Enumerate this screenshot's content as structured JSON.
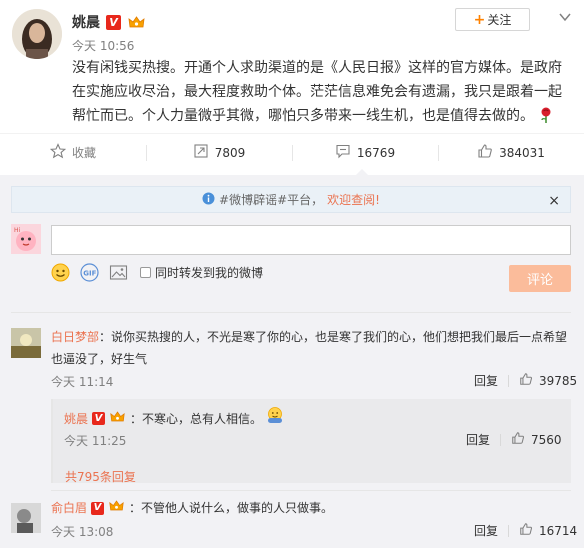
{
  "post": {
    "author": "姚晨",
    "verified_badge": "V",
    "time": "今天 10:56",
    "follow_label": "关注",
    "text_lines": [
      "没有闲钱买热搜。开通个人求助渠道的是《人民日报》这样的官方媒体。是政府",
      "在实施应收尽治，最大程度救助个体。茫茫信息难免会有遗漏，我只是跟着一起",
      "帮忙而已。个人力量微乎其微，哪怕只多带来一线生机，也是值得去做的。"
    ],
    "icons": {
      "follow": "plus-icon",
      "more": "chevron-down-icon",
      "emoji": "rose-emoji-icon"
    }
  },
  "actions": {
    "favorite": {
      "label": "收藏",
      "icon": "star-icon"
    },
    "repost": {
      "count": "7809",
      "icon": "repost-icon"
    },
    "comment": {
      "count": "16769",
      "icon": "comment-icon"
    },
    "like": {
      "count": "384031",
      "icon": "thumbs-up-icon"
    }
  },
  "notice": {
    "prefix": "#微博辟谣#平台，",
    "link": "欢迎查阅!",
    "close": "×"
  },
  "composer": {
    "placeholder": "",
    "repost_label": "同时转发到我的微博",
    "submit_label": "评论",
    "tools": [
      "emoji-icon",
      "gif-icon",
      "image-icon"
    ]
  },
  "comments": [
    {
      "name": "白日梦部",
      "text_line1": "：说你买热搜的人，不光是寒了你的心，也是寒了我们的心，他们想把我们最后一点希望",
      "text_line2": "也逼没了，好生气",
      "time": "今天 11:14",
      "reply_label": "回复",
      "likes": "39785",
      "reply": {
        "name": "姚晨",
        "verified_badge": "V",
        "text": "：不寒心，总有人相信。",
        "time": "今天 11:25",
        "reply_label": "回复",
        "likes": "7560",
        "more": "共795条回复"
      }
    },
    {
      "name": "俞白眉",
      "verified_badge": "V",
      "text": "：不管他人说什么，做事的人只做事。",
      "time": "今天 13:08",
      "reply_label": "回复",
      "likes": "16714"
    }
  ],
  "colors": {
    "link": "#eb7350",
    "verified": "#e8281c",
    "submit_disabled": "#fbbc9b",
    "comment_bg": "#f2f2f5",
    "notice_bg": "#eaf1f7"
  }
}
